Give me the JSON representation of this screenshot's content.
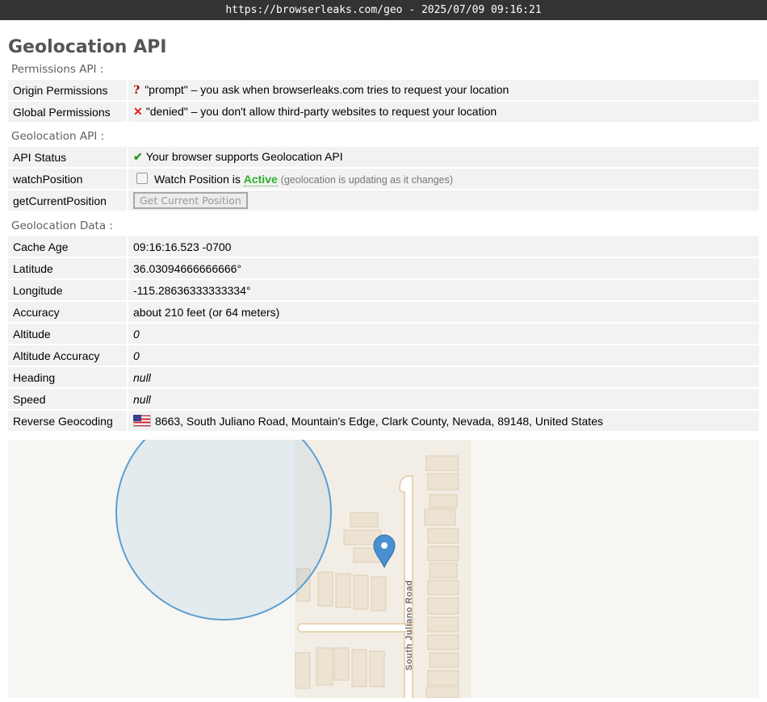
{
  "window": {
    "title": "https://browserleaks.com/geo - 2025/07/09 09:16:21"
  },
  "page_title": "Geolocation API",
  "permissions": {
    "heading": "Permissions API :",
    "rows": [
      {
        "label": "Origin Permissions",
        "icon": "question-icon",
        "value": "\"prompt\" – you ask when browserleaks.com tries to request your location"
      },
      {
        "label": "Global Permissions",
        "icon": "cross-icon",
        "value": "\"denied\" – you don't allow third-party websites to request your location"
      }
    ]
  },
  "geoapi": {
    "heading": "Geolocation API :",
    "api_status": {
      "label": "API Status",
      "value": "Your browser supports Geolocation API"
    },
    "watch": {
      "label": "watchPosition",
      "prefix": "Watch Position is",
      "state": "Active",
      "note": "(geolocation is updating as it changes)",
      "checked": false
    },
    "current": {
      "label": "getCurrentPosition",
      "button": "Get Current Position"
    }
  },
  "geodata": {
    "heading": "Geolocation Data :",
    "rows": [
      {
        "label": "Cache Age",
        "value": "09:16:16.523 -0700"
      },
      {
        "label": "Latitude",
        "value": "36.03094666666666°"
      },
      {
        "label": "Longitude",
        "value": "-115.28636333333334°"
      },
      {
        "label": "Accuracy",
        "value": "about 210 feet (or 64 meters)"
      },
      {
        "label": "Altitude",
        "value": "0"
      },
      {
        "label": "Altitude Accuracy",
        "value": "0"
      },
      {
        "label": "Heading",
        "value": "null"
      },
      {
        "label": "Speed",
        "value": "null"
      },
      {
        "label": "Reverse Geocoding",
        "value": "8663, South Juliano Road, Mountain's Edge, Clark County, Nevada, 89148, United States"
      }
    ]
  },
  "map": {
    "road_label": "South Juliano Road",
    "marker_icon": "map-pin-icon",
    "accuracy_color": "#5a9fd4",
    "marker_color": "#4a8fd0"
  },
  "colors": {
    "active": "#2ab02a",
    "check": "#2a9a2a",
    "cross": "#e02020",
    "question": "#b00000"
  }
}
